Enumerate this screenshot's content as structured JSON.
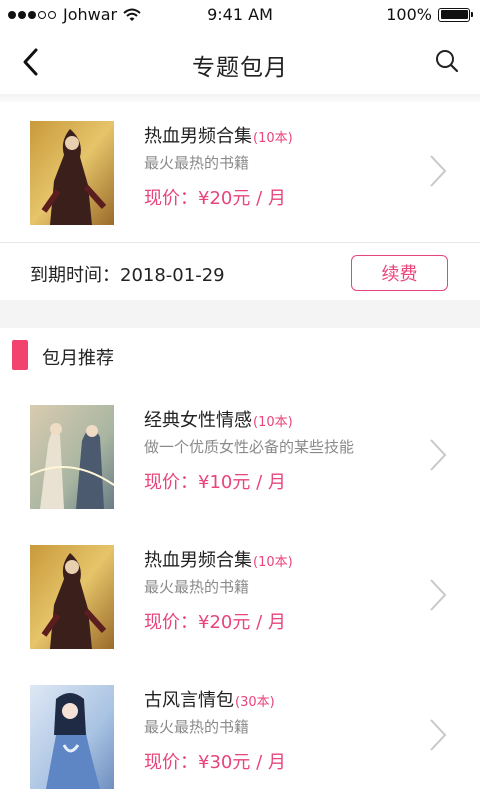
{
  "status_bar": {
    "carrier": "Johwar",
    "time": "9:41 AM",
    "battery": "100%"
  },
  "nav": {
    "title": "专题包月",
    "back_icon": "chevron-left-icon",
    "search_icon": "search-icon"
  },
  "subscribed": {
    "title": "热血男频合集",
    "count": "(10本)",
    "desc": "最火最热的书籍",
    "price": "现价：¥20元 / 月"
  },
  "expiry": {
    "label": "到期时间：",
    "date": "2018-01-29",
    "renew_label": "续费"
  },
  "recommend": {
    "title": "包月推荐",
    "items": [
      {
        "title": "经典女性情感",
        "count": "(10本)",
        "desc": "做一个优质女性必备的某些技能",
        "price": "现价：¥10元 / 月"
      },
      {
        "title": "热血男频合集",
        "count": "(10本)",
        "desc": "最火最热的书籍",
        "price": "现价：¥20元 / 月"
      },
      {
        "title": "古风言情包",
        "count": "(30本)",
        "desc": "最火最热的书籍",
        "price": "现价：¥30元 / 月"
      }
    ]
  },
  "colors": {
    "accent": "#e8457a",
    "section_bar": "#f2426e",
    "muted_text": "#8a8a8a",
    "gap_bg": "#f4f4f4"
  }
}
